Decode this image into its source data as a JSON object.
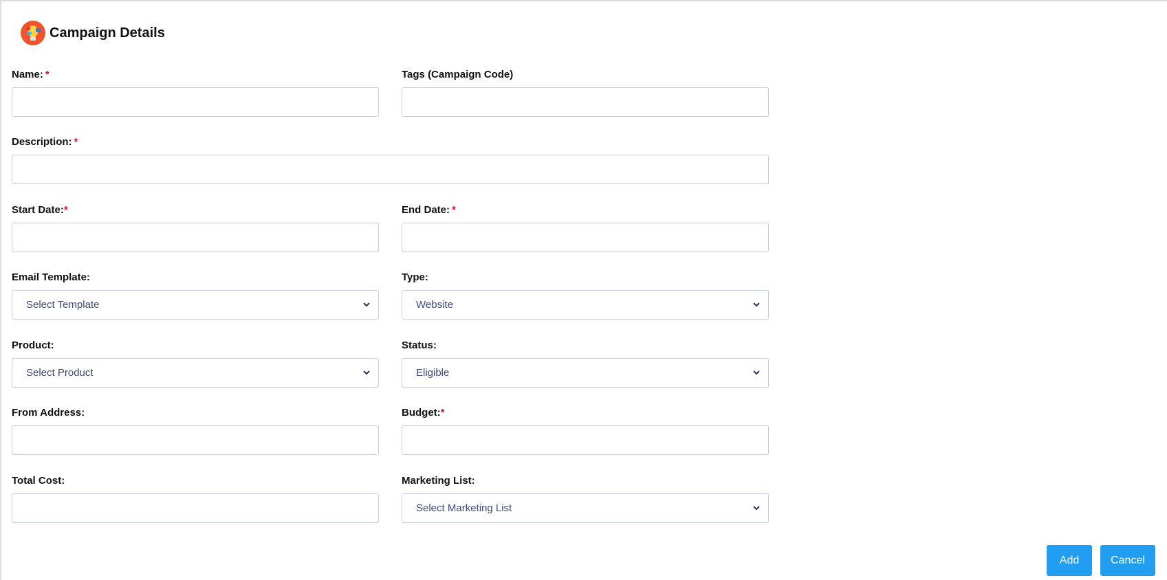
{
  "header": {
    "title": "Campaign Details",
    "logo_icon": "campaign-lightbulb-logo"
  },
  "form": {
    "name": {
      "label": "Name:",
      "required": "*",
      "value": ""
    },
    "tags": {
      "label": "Tags (Campaign Code)",
      "value": ""
    },
    "description": {
      "label": "Description:",
      "required": "*",
      "value": ""
    },
    "start_date": {
      "label": "Start Date:",
      "required": "*",
      "value": ""
    },
    "end_date": {
      "label": "End Date:",
      "required": "*",
      "value": ""
    },
    "email_template": {
      "label": "Email Template:",
      "selected": "Select Template"
    },
    "type": {
      "label": "Type:",
      "selected": "Website"
    },
    "product": {
      "label": "Product:",
      "selected": "Select Product"
    },
    "status": {
      "label": "Status:",
      "selected": "Eligible"
    },
    "from_address": {
      "label": "From Address:",
      "value": ""
    },
    "budget": {
      "label": "Budget:",
      "required": "*",
      "value": ""
    },
    "total_cost": {
      "label": "Total Cost:",
      "value": ""
    },
    "marketing_list": {
      "label": "Marketing List:",
      "selected": "Select Marketing List"
    }
  },
  "actions": {
    "add_label": "Add",
    "cancel_label": "Cancel"
  },
  "colors": {
    "primary_button": "#219ef0",
    "required_asterisk": "#e8102a",
    "select_text": "#3b4780",
    "input_border": "#c7cbe3",
    "logo_bg": "#f0542a"
  }
}
